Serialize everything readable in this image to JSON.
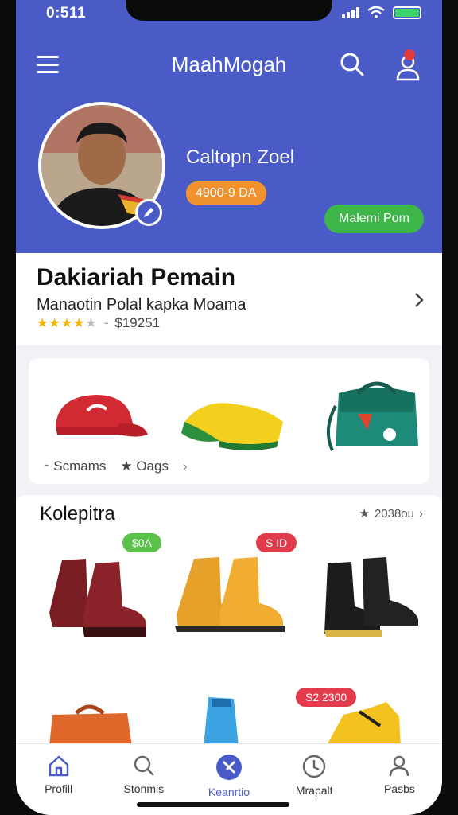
{
  "status": {
    "time": "0:511"
  },
  "header": {
    "title": "MaahMogah"
  },
  "profile": {
    "name": "Caltopn Zoel",
    "tag": "4900-9 DA",
    "follow_label": "Malemi Pom"
  },
  "info": {
    "title": "Dakiariah Pemain",
    "subtitle": "Manaotin Polal kapka Moama",
    "rating": 3.5,
    "rating_text": "$19251"
  },
  "accessories": {
    "items": [
      {
        "icon": "red-cap-icon"
      },
      {
        "icon": "scarf-icon"
      },
      {
        "icon": "bag-icon"
      }
    ],
    "tabs": [
      "Scmams",
      "Oags"
    ]
  },
  "collection": {
    "title": "Kolepitra",
    "meta": "2038ou",
    "badges": [
      {
        "label": "$0A",
        "color": "#5cc14a"
      },
      {
        "label": "S ID",
        "color": "#e23b4b"
      },
      {
        "label": "S2 2300",
        "color": "#e23b4b"
      }
    ]
  },
  "bottom_nav": [
    {
      "label": "Profill",
      "icon": "home-icon"
    },
    {
      "label": "Stonmis",
      "icon": "search-icon"
    },
    {
      "label": "Keanrtio",
      "icon": "explore-icon"
    },
    {
      "label": "Mrapalt",
      "icon": "clock-icon"
    },
    {
      "label": "Pasbs",
      "icon": "user-icon"
    }
  ],
  "colors": {
    "primary": "#4a5bc7",
    "accent_orange": "#f0922e",
    "accent_green": "#3fb64a"
  }
}
